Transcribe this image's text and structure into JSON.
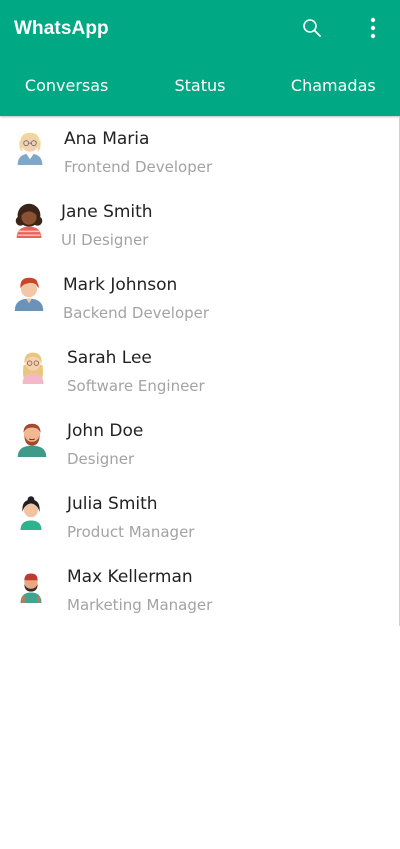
{
  "app": {
    "title": "WhatsApp",
    "accent_color": "#00a884"
  },
  "header": {
    "search_icon": "search-icon",
    "menu_icon": "more-vertical-icon"
  },
  "tabs": [
    {
      "label": "Conversas",
      "active": true
    },
    {
      "label": "Status",
      "active": false
    },
    {
      "label": "Chamadas",
      "active": false
    }
  ],
  "contacts": [
    {
      "name": "Ana Maria",
      "role": "Frontend Developer",
      "avatar": "avatar-blonde-woman-glasses"
    },
    {
      "name": "Jane Smith",
      "role": "UI Designer",
      "avatar": "avatar-curly-hair-woman"
    },
    {
      "name": "Mark Johnson",
      "role": "Backend Developer",
      "avatar": "avatar-redhead-man"
    },
    {
      "name": "Sarah Lee",
      "role": "Software Engineer",
      "avatar": "avatar-blonde-woman-pink"
    },
    {
      "name": "John Doe",
      "role": "Designer",
      "avatar": "avatar-bearded-man"
    },
    {
      "name": "Julia Smith",
      "role": "Product Manager",
      "avatar": "avatar-dark-hair-woman"
    },
    {
      "name": "Max Kellerman",
      "role": "Marketing Manager",
      "avatar": "avatar-man-cap"
    }
  ]
}
